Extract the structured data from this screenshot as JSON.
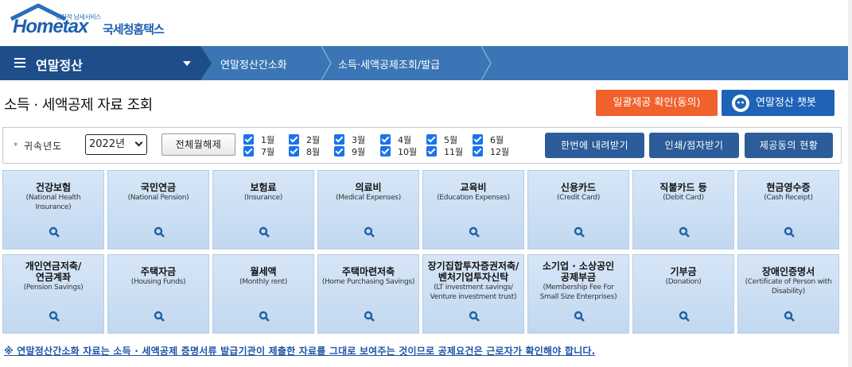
{
  "header": {
    "logo_small": "전자적 납세서비스",
    "logo_word": "Hometax",
    "logo_org": "국세청홈택스"
  },
  "nav": {
    "menu_title": "연말정산",
    "crumbs": [
      "연말정산간소화",
      "소득·세액공제조회/발급"
    ]
  },
  "page": {
    "title": "소득 · 세액공제 자료 조회",
    "consent_button": "일괄제공 확인(동의)",
    "chatbot_button": "연말정산 챗봇"
  },
  "filter": {
    "year_label": "귀속년도",
    "year_value": "2022년",
    "toggle_all_button": "전체월해제",
    "months": [
      "1월",
      "2월",
      "3월",
      "4월",
      "5월",
      "6월",
      "7월",
      "8월",
      "9월",
      "10월",
      "11월",
      "12월"
    ],
    "download_all_button": "한번에 내려받기",
    "print_button": "인쇄/점자받기",
    "consent_status_button": "제공동의 현황"
  },
  "tiles": [
    {
      "title": "건강보험",
      "sub": [
        "(National Health",
        "Insurance)"
      ]
    },
    {
      "title": "국민연금",
      "sub": [
        "(National Pension)"
      ]
    },
    {
      "title": "보험료",
      "sub": [
        "(Insurance)"
      ]
    },
    {
      "title": "의료비",
      "sub": [
        "(Medical Expenses)"
      ]
    },
    {
      "title": "교육비",
      "sub": [
        "(Education Expenses)"
      ]
    },
    {
      "title": "신용카드",
      "sub": [
        "(Credit Card)"
      ]
    },
    {
      "title": "직불카드 등",
      "sub": [
        "(Debit Card)"
      ]
    },
    {
      "title": "현금영수증",
      "sub": [
        "(Cash Receipt)"
      ]
    },
    {
      "title": "개인연금저축/",
      "title2": "연금계좌",
      "sub": [
        "(Pension Savings)"
      ]
    },
    {
      "title": "주택자금",
      "sub": [
        "(Housing Funds)"
      ]
    },
    {
      "title": "월세액",
      "sub": [
        "(Monthly rent)"
      ]
    },
    {
      "title": "주택마련저축",
      "sub": [
        "(Home Purchasing Savings)"
      ]
    },
    {
      "title": "장기집합투자증권저축/",
      "title2": "벤처기업투자신탁",
      "sub": [
        "(LT investment savings/",
        "Venture investment trust)"
      ]
    },
    {
      "title": "소기업 · 소상공인",
      "title2": "공제부금",
      "sub": [
        "(Membership Fee For",
        "Small Size Enterprises)"
      ]
    },
    {
      "title": "기부금",
      "sub": [
        "(Donation)"
      ]
    },
    {
      "title": "장애인증명서",
      "sub": [
        "(Certificate of Person with",
        "Disability)"
      ]
    }
  ],
  "notice": "※ 연말정산간소화 자료는 소득 · 세액공제 증명서류 발급기관이 제출한 자료를 그대로 보여주는 것이므로 공제요건은 근로자가 확인해야 합니다.",
  "colors": {
    "nav_bar": "#3b75b5",
    "nav_main": "#1e4d8a",
    "consent_orange": "#f1612c",
    "chatbot_blue": "#1f63b8",
    "action_blue": "#2c5d9a",
    "tile_bg": "#c9ddf2",
    "checkbox_blue": "#1a73e8"
  }
}
